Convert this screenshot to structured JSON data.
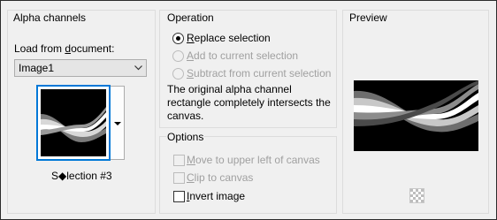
{
  "alpha_channels": {
    "title": "Alpha channels",
    "load_label_pre": "Load from ",
    "load_label_u": "d",
    "load_label_post": "ocument:",
    "document_selected": "Image1",
    "selection_caption": "S◆lection #3"
  },
  "operation": {
    "title": "Operation",
    "replace_u": "R",
    "replace_rest": "eplace selection",
    "add_u": "A",
    "add_rest": "dd to current selection",
    "subtract_u": "S",
    "subtract_rest": "ubtract from current selection",
    "description": "The original alpha channel rectangle completely intersects the canvas."
  },
  "options": {
    "title": "Options",
    "move_u": "M",
    "move_rest": "ove to upper left of canvas",
    "clip_u": "C",
    "clip_rest": "lip to canvas",
    "invert_u": "I",
    "invert_rest": "nvert image"
  },
  "preview": {
    "title": "Preview"
  }
}
